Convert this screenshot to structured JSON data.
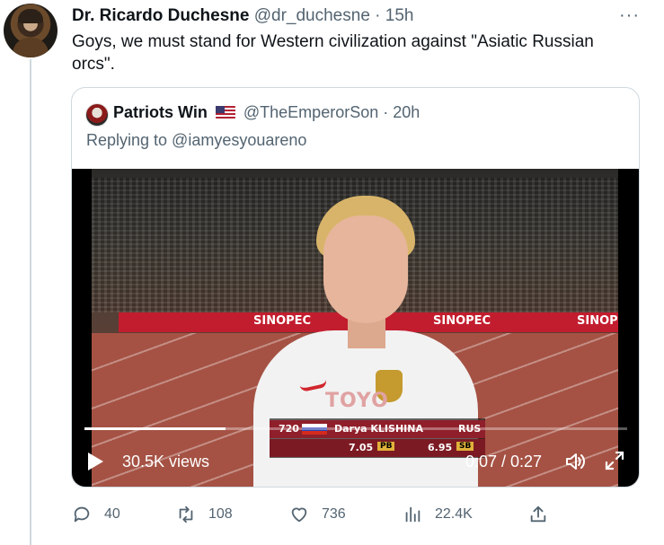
{
  "tweet": {
    "author": {
      "display_name": "Dr. Ricardo Duchesne",
      "handle": "@dr_duchesne",
      "separator": "·",
      "time": "15h"
    },
    "more_label": "···",
    "text": "Goys, we must stand for Western civilization against \"Asiatic Russian orcs\"."
  },
  "quote": {
    "author": {
      "display_name": "Patriots Win",
      "flag": "us-flag-emoji",
      "handle": "@TheEmperorSon",
      "separator": "·",
      "time": "20h"
    },
    "replying_to": "Replying to @iamyesyouareno",
    "video": {
      "scene_banner_texts": [
        "SINOPEC",
        "SINOPEC",
        "SINOPEC"
      ],
      "shirt_text": "TOYO",
      "lower_third": {
        "number": "720",
        "name": "Darya KLISHINA",
        "country": "RUS",
        "pb_value": "7.05",
        "pb_label": "PB",
        "sb_value": "6.95",
        "sb_label": "SB"
      },
      "progress": 0.26,
      "views": "30.5K views",
      "time": "0:07 / 0:27",
      "icons": {
        "play": "play-icon",
        "volume": "volume-icon",
        "fullscreen": "fullscreen-icon"
      }
    }
  },
  "actions": {
    "replies": "40",
    "retweets": "108",
    "likes": "736",
    "views": "22.4K"
  },
  "colors": {
    "text": "#0f1419",
    "muted": "#536471",
    "border": "#cfd9de"
  }
}
